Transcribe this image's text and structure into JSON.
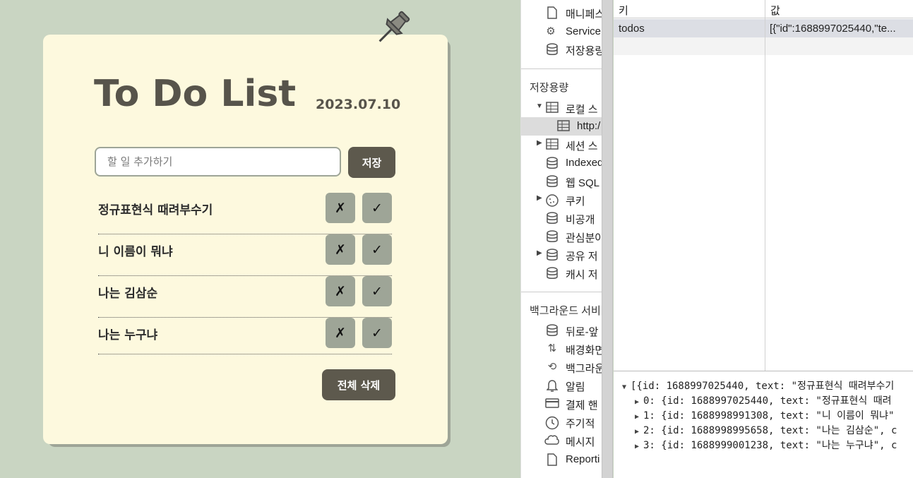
{
  "app": {
    "title": "To Do List",
    "date": "2023.07.10",
    "input_placeholder": "할 일 추가하기",
    "save_label": "저장",
    "delete_symbol": "✗",
    "done_symbol": "✓",
    "clear_label": "전체 삭제",
    "todos": [
      "정규표현식 때려부수기",
      "니 이름이 뭐냐",
      "나는 김삼순",
      "나는 누구냐"
    ]
  },
  "devtools": {
    "sidebar": {
      "top_items": [
        "매니페스",
        "Service",
        "저장용량"
      ],
      "storage_header": "저장용량",
      "local_storage": "로컬 스",
      "local_storage_child": "http:/",
      "session_storage": "세션 스",
      "indexed_db": "IndexedI",
      "web_sql": "웹 SQL",
      "cookies": "쿠키",
      "private": "비공개",
      "interest": "관심분야",
      "shared": "공유 저",
      "cache": "캐시 저",
      "background_header": "백그라운드 서비",
      "background_items": [
        "뒤로-앞",
        "배경화면",
        "백그라운",
        "알림",
        "결제 핸",
        "주기적",
        "메시지",
        "Reporti"
      ]
    },
    "table": {
      "col_key": "키",
      "col_value": "값",
      "rows": [
        {
          "key": "todos",
          "value": "[{\"id\":1688997025440,\"te..."
        }
      ]
    },
    "console": {
      "summary": "[{id: 1688997025440, text: \"정규표현식 때려부수기",
      "items": [
        "0: {id: 1688997025440, text: \"정규표현식 때려",
        "1: {id: 1688998991308, text: \"니 이름이 뭐냐\"",
        "2: {id: 1688998995658, text: \"나는 김삼순\", c",
        "3: {id: 1688999001238, text: \"나는 누구냐\", c"
      ]
    }
  },
  "colors": {
    "background": "#c9d5c2",
    "card": "#fdf9de",
    "dark_button": "#5d594d",
    "sage_button": "#9ea597"
  }
}
